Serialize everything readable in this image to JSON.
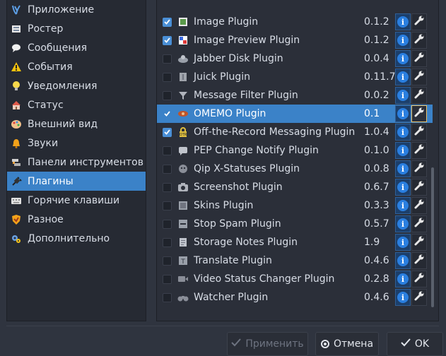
{
  "sidebar": {
    "items": [
      {
        "label": "Приложение",
        "icon": "application-icon"
      },
      {
        "label": "Ростер",
        "icon": "roster-icon"
      },
      {
        "label": "Сообщения",
        "icon": "messages-icon"
      },
      {
        "label": "События",
        "icon": "events-warning-icon"
      },
      {
        "label": "Уведомления",
        "icon": "notifications-bulb-icon"
      },
      {
        "label": "Статус",
        "icon": "status-icon"
      },
      {
        "label": "Внешний вид",
        "icon": "appearance-palette-icon"
      },
      {
        "label": "Звуки",
        "icon": "sounds-bell-icon"
      },
      {
        "label": "Панели инструментов",
        "icon": "toolbars-icon"
      },
      {
        "label": "Плагины",
        "icon": "plugins-plug-icon"
      },
      {
        "label": "Горячие клавиши",
        "icon": "shortcuts-keyboard-icon"
      },
      {
        "label": "Разное",
        "icon": "misc-shield-icon"
      },
      {
        "label": "Дополнительно",
        "icon": "advanced-gears-icon"
      }
    ],
    "active_index": 9
  },
  "plugins": [
    {
      "name": "Image Plugin",
      "version": "0.1.2",
      "enabled": true,
      "icon": "image-icon"
    },
    {
      "name": "Image Preview Plugin",
      "version": "0.1.2",
      "enabled": true,
      "icon": "image-preview-icon"
    },
    {
      "name": "Jabber Disk Plugin",
      "version": "0.0.4",
      "enabled": false,
      "icon": "disk-icon"
    },
    {
      "name": "Juick Plugin",
      "version": "0.11.7",
      "enabled": false,
      "icon": "juick-icon"
    },
    {
      "name": "Message Filter Plugin",
      "version": "0.0.2",
      "enabled": false,
      "icon": "filter-funnel-icon"
    },
    {
      "name": "OMEMO Plugin",
      "version": "0.1",
      "enabled": true,
      "icon": "omemo-icon",
      "selected": true
    },
    {
      "name": "Off-the-Record Messaging Plugin",
      "version": "1.0.4",
      "enabled": true,
      "icon": "otr-lock-icon"
    },
    {
      "name": "PEP Change Notify Plugin",
      "version": "0.1.0",
      "enabled": false,
      "icon": "pep-notify-icon"
    },
    {
      "name": "Qip X-Statuses Plugin",
      "version": "0.0.8",
      "enabled": false,
      "icon": "qip-icon"
    },
    {
      "name": "Screenshot Plugin",
      "version": "0.6.7",
      "enabled": false,
      "icon": "camera-icon"
    },
    {
      "name": "Skins Plugin",
      "version": "0.3.3",
      "enabled": false,
      "icon": "skins-icon"
    },
    {
      "name": "Stop Spam Plugin",
      "version": "0.5.7",
      "enabled": false,
      "icon": "stop-spam-icon"
    },
    {
      "name": "Storage Notes Plugin",
      "version": "1.9",
      "enabled": false,
      "icon": "notes-icon"
    },
    {
      "name": "Translate Plugin",
      "version": "0.4.6",
      "enabled": false,
      "icon": "translate-icon"
    },
    {
      "name": "Video Status Changer Plugin",
      "version": "0.2.8",
      "enabled": false,
      "icon": "video-icon"
    },
    {
      "name": "Watcher Plugin",
      "version": "0.4.6",
      "enabled": false,
      "icon": "binoculars-icon"
    }
  ],
  "buttons": {
    "apply": "Применить",
    "cancel": "Отмена",
    "ok": "OK"
  },
  "colors": {
    "accent": "#3b82c8",
    "background": "#2f343f",
    "info": "#2a7fe0"
  }
}
